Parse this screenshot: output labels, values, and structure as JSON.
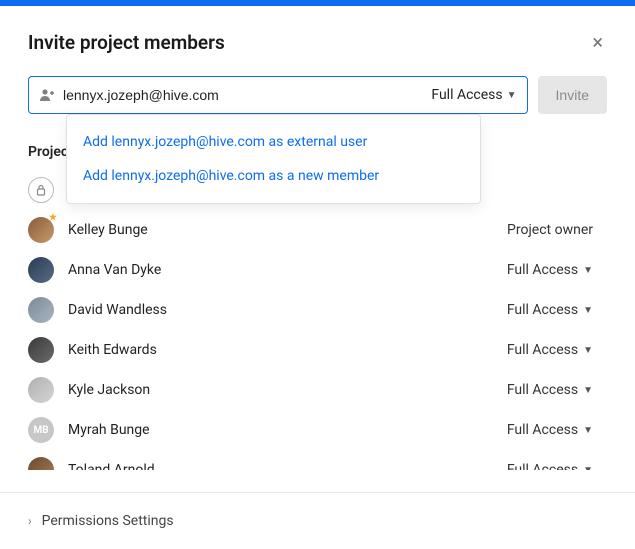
{
  "dialog": {
    "title": "Invite project members",
    "close_icon": "×"
  },
  "invite": {
    "email_value": "lennyx.jozeph@hive.com",
    "access_label": "Full Access",
    "button_label": "Invite"
  },
  "autocomplete": {
    "items": [
      "Add lennyx.jozeph@hive.com as external user",
      "Add lennyx.jozeph@hive.com as a new member"
    ]
  },
  "members_section_label": "Project members",
  "members": [
    {
      "name": "",
      "role": "",
      "avatar_type": "lock",
      "avatar_bg": "#ffffff",
      "initials": ""
    },
    {
      "name": "Kelley Bunge",
      "role": "Project owner",
      "avatar_type": "photo star",
      "avatar_bg": "linear-gradient(135deg,#8a5c3b,#c79a6b)",
      "initials": ""
    },
    {
      "name": "Anna Van Dyke",
      "role": "Full Access",
      "avatar_type": "photo",
      "avatar_bg": "linear-gradient(135deg,#2a3b55,#5a6b85)",
      "initials": ""
    },
    {
      "name": "David Wandless",
      "role": "Full Access",
      "avatar_type": "photo",
      "avatar_bg": "linear-gradient(135deg,#7a8a9a,#aab5c0)",
      "initials": ""
    },
    {
      "name": "Keith Edwards",
      "role": "Full Access",
      "avatar_type": "photo",
      "avatar_bg": "linear-gradient(135deg,#3a3a3a,#6a6a6a)",
      "initials": ""
    },
    {
      "name": "Kyle Jackson",
      "role": "Full Access",
      "avatar_type": "photo",
      "avatar_bg": "linear-gradient(135deg,#b0b0b0,#d5d5d5)",
      "initials": ""
    },
    {
      "name": "Myrah Bunge",
      "role": "Full Access",
      "avatar_type": "initials",
      "avatar_bg": "#c7c7c7",
      "initials": "MB"
    },
    {
      "name": "Toland Arnold",
      "role": "Full Access",
      "avatar_type": "photo",
      "avatar_bg": "linear-gradient(135deg,#6b4a2f,#a87d55)",
      "initials": ""
    }
  ],
  "role_dropdown_roles": [
    "Project owner"
  ],
  "footer": {
    "label": "Permissions Settings"
  }
}
